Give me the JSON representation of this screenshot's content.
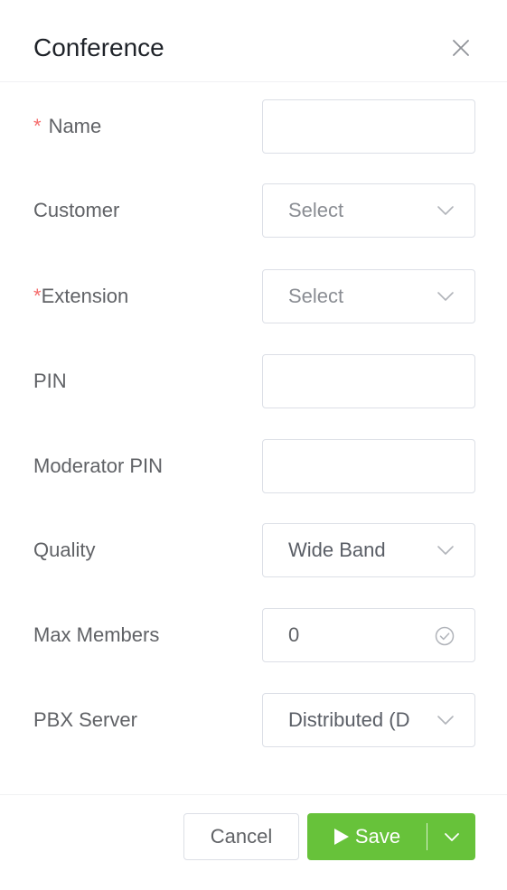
{
  "dialog": {
    "title": "Conference",
    "close_icon": "close-icon"
  },
  "fields": {
    "name": {
      "required_mark": "*",
      "label": "Name",
      "value": ""
    },
    "customer": {
      "label": "Customer",
      "placeholder": "Select"
    },
    "extension": {
      "required_mark": "*",
      "label": "Extension",
      "placeholder": "Select"
    },
    "pin": {
      "label": "PIN",
      "value": ""
    },
    "moderator_pin": {
      "label": "Moderator PIN",
      "value": ""
    },
    "quality": {
      "label": "Quality",
      "value": "Wide Band"
    },
    "max_members": {
      "label": "Max Members",
      "value": "0"
    },
    "pbx_server": {
      "label": "PBX Server",
      "value": "Distributed (D"
    }
  },
  "footer": {
    "cancel_label": "Cancel",
    "save_label": "Save"
  },
  "colors": {
    "required": "#f56c6c",
    "save_button": "#67c23a",
    "border": "#dcdfe6",
    "text": "#606266",
    "title": "#1f2329"
  }
}
